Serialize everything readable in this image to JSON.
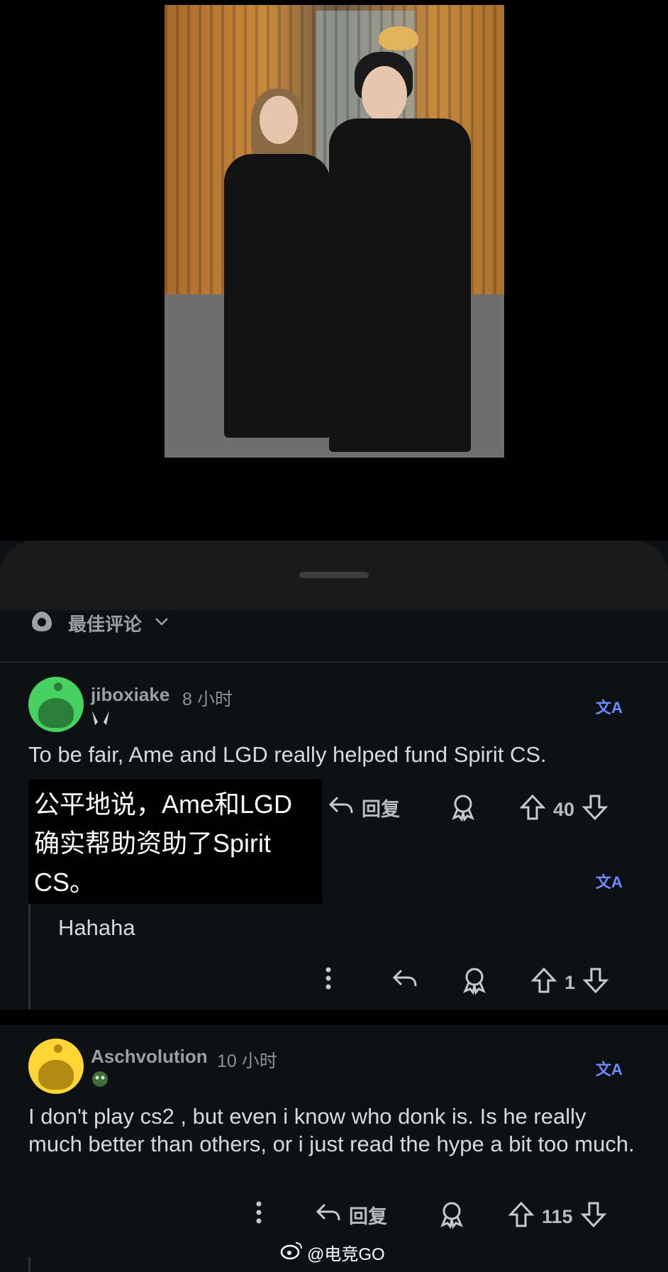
{
  "sort": {
    "label": "最佳评论"
  },
  "comments": [
    {
      "username": "jiboxiake",
      "time": "8 小时",
      "text": "To be fair, Ame and LGD really helped fund Spirit CS.",
      "translation_overlay": "公平地说，Ame和LGD确实帮助资助了Spirit CS。",
      "reply_label": "回复",
      "votes": "40",
      "avatar_color": "#46d160",
      "replies": [
        {
          "text": "Hahaha",
          "votes": "1"
        }
      ]
    },
    {
      "username": "Aschvolution",
      "time": "10 小时",
      "text": "I don't play cs2 , but even i know who donk is. Is he really much better than others, or i just read the hype a bit too much.",
      "reply_label": "回复",
      "votes": "115",
      "avatar_color": "#ffd635"
    }
  ],
  "translate_glyph": "文A",
  "watermark": "@电竞GO",
  "icons": [
    "translate-icon",
    "reply-icon",
    "award-icon",
    "upvote-icon",
    "downvote-icon",
    "more-icon",
    "sort-icon",
    "chevron-down-icon",
    "weibo-icon"
  ]
}
